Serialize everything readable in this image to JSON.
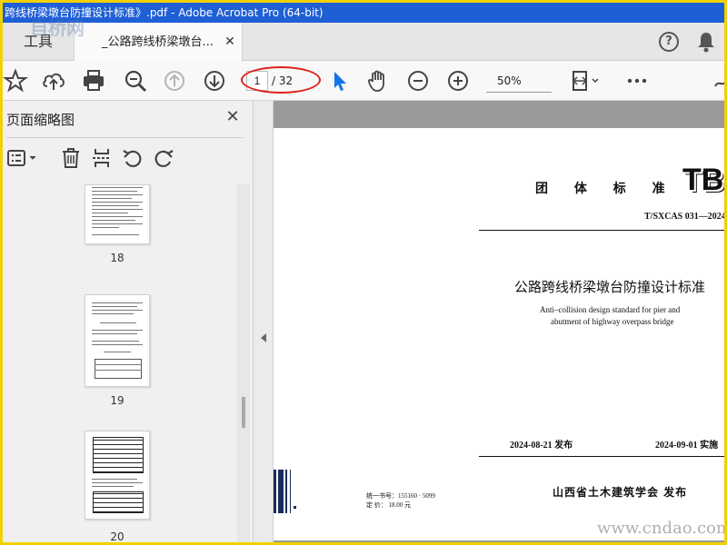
{
  "window": {
    "title": "跨线桥梁墩台防撞设计标准》.pdf - Adobe Acrobat Pro (64-bit)"
  },
  "tabs": {
    "tools_label": "工具",
    "doc_label": "_公路跨线桥梁墩台..."
  },
  "header_icons": [
    "help-icon",
    "bell-icon"
  ],
  "toolbar": {
    "icons": [
      "star-icon",
      "upload-icon",
      "print-icon",
      "zoom-search-icon",
      "page-up-icon",
      "page-down-icon",
      "select-pointer-icon",
      "hand-icon",
      "zoom-out-icon",
      "zoom-in-icon",
      "fit-page-icon",
      "more-icon"
    ],
    "page_current": "1",
    "page_total": "/ 32",
    "zoom": "50%"
  },
  "sidebar": {
    "title": "页面缩略图",
    "tools": [
      "options-menu-icon",
      "delete-icon",
      "extract-icon",
      "rotate-ccw-icon",
      "rotate-cw-icon"
    ],
    "thumbnails": [
      {
        "label": "18"
      },
      {
        "label": "19"
      },
      {
        "label": "20"
      }
    ]
  },
  "document": {
    "category": "团 体 标 准",
    "series": "TB",
    "code": "T/SXCAS 031—2024",
    "title": "公路跨线桥梁墩台防撞设计标准",
    "title_en_1": "Anti–collision design standard for pier and",
    "title_en_2": "abutment of highway overpass bridge",
    "issue_date": "2024-08-21  发布",
    "implement_date": "2024-09-01  实施",
    "publisher": "山西省土木建筑学会   发布",
    "isbn": "统一书号：155160 · 5099",
    "price": "定    价：    18.00    元"
  },
  "watermarks": {
    "top_left": "自桥网",
    "bottom_right": "www.cndao.com"
  },
  "colors": {
    "titlebar": "#1f5fd6",
    "frame": "#f3d000",
    "highlight": "#e0201a",
    "select_pointer": "#1473e6"
  }
}
